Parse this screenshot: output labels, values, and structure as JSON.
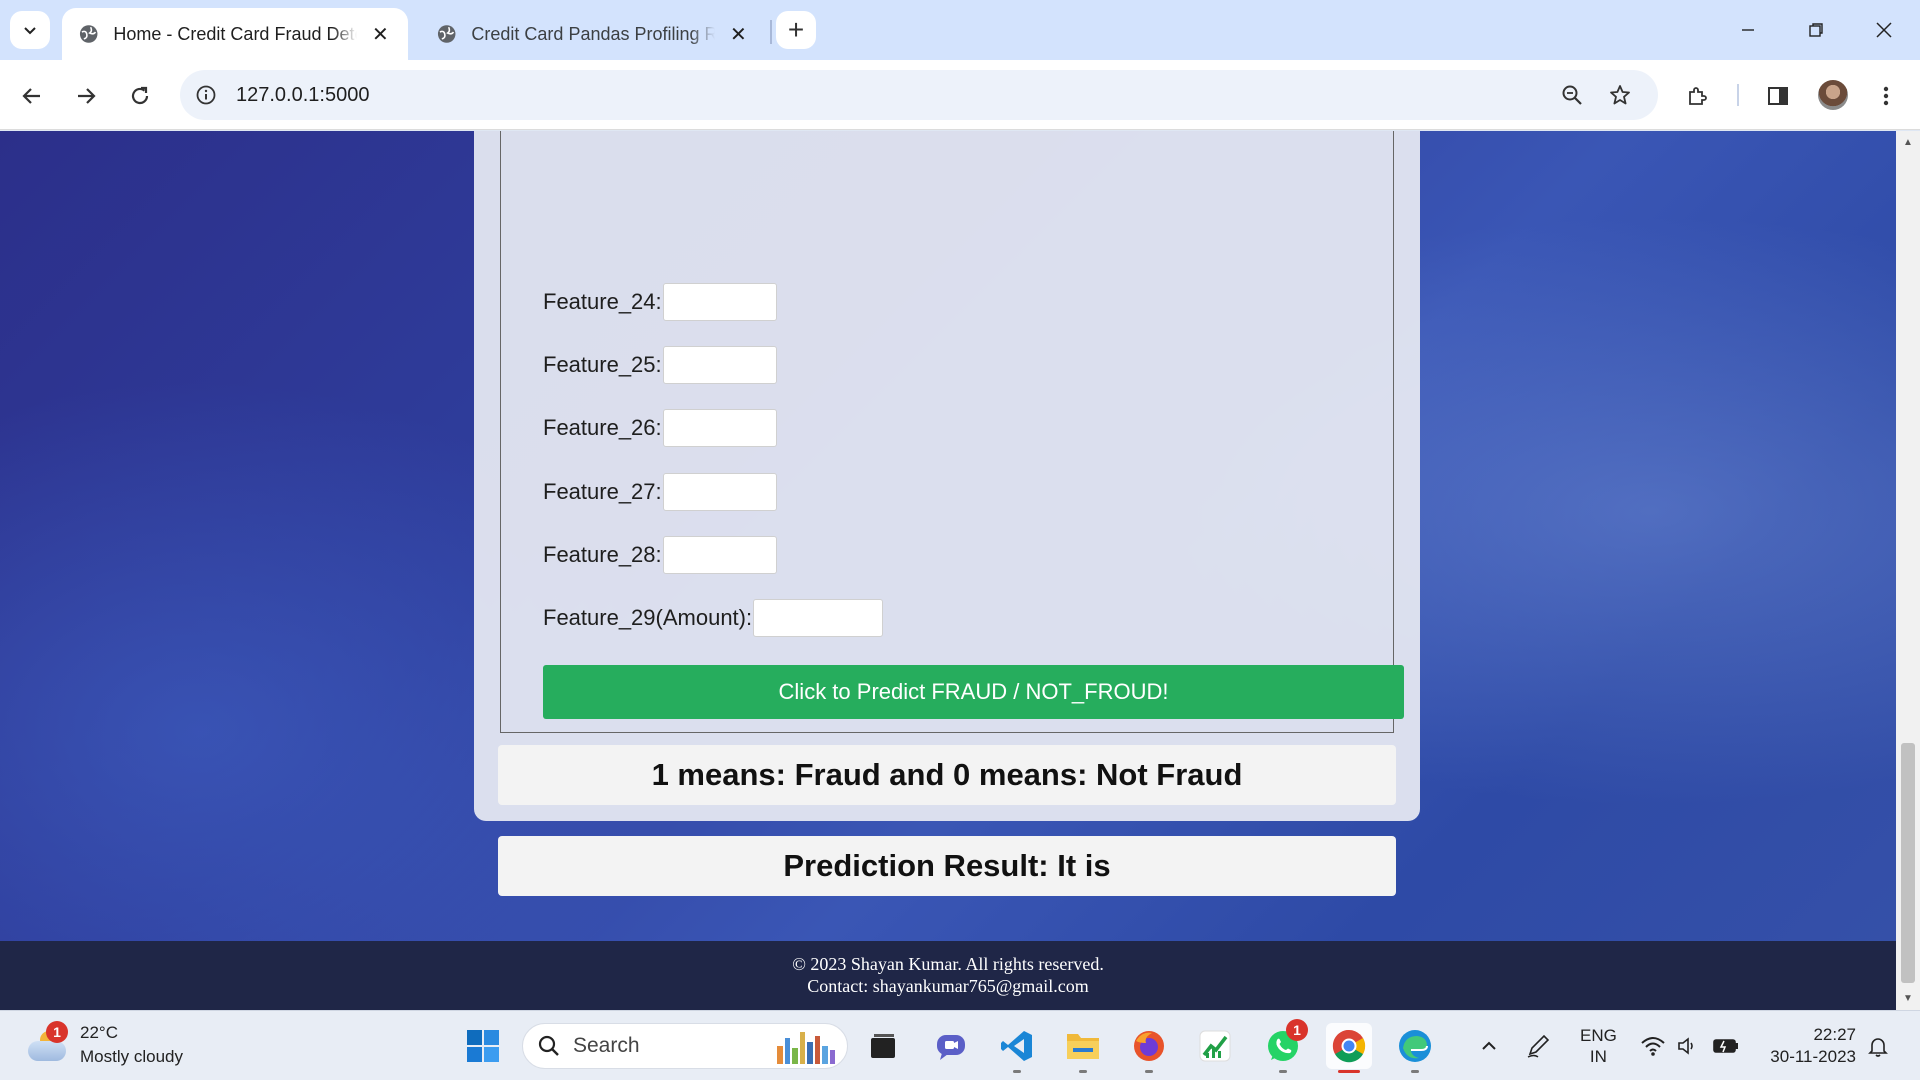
{
  "browser": {
    "tabs": [
      {
        "title": "Home - Credit Card Fraud Detection",
        "active": true
      },
      {
        "title": "Credit Card Pandas Profiling Report",
        "active": false
      }
    ],
    "url": "127.0.0.1:5000"
  },
  "form": {
    "fields": [
      {
        "label": "Feature_24:",
        "value": ""
      },
      {
        "label": "Feature_25:",
        "value": ""
      },
      {
        "label": "Feature_26:",
        "value": ""
      },
      {
        "label": "Feature_27:",
        "value": ""
      },
      {
        "label": "Feature_28:",
        "value": ""
      },
      {
        "label": "Feature_29(Amount):",
        "value": ""
      }
    ],
    "submit_label": "Click to Predict FRAUD / NOT_FROUD!"
  },
  "legend_text": "1 means: Fraud and 0 means: Not Fraud",
  "prediction_text": "Prediction Result: It is",
  "footer": {
    "copyright": "© 2023 Shayan Kumar. All rights reserved.",
    "contact": "Contact: shayankumar765@gmail.com"
  },
  "taskbar": {
    "weather_temp": "22°C",
    "weather_desc": "Mostly cloudy",
    "weather_badge": "1",
    "search_label": "Search",
    "whatsapp_badge": "1",
    "language_line1": "ENG",
    "language_line2": "IN",
    "time": "22:27",
    "date": "30-11-2023"
  },
  "colors": {
    "accent_button": "#26ad5d",
    "footer_bg": "#1f2647",
    "tabbar_bg": "#d3e3fd"
  }
}
